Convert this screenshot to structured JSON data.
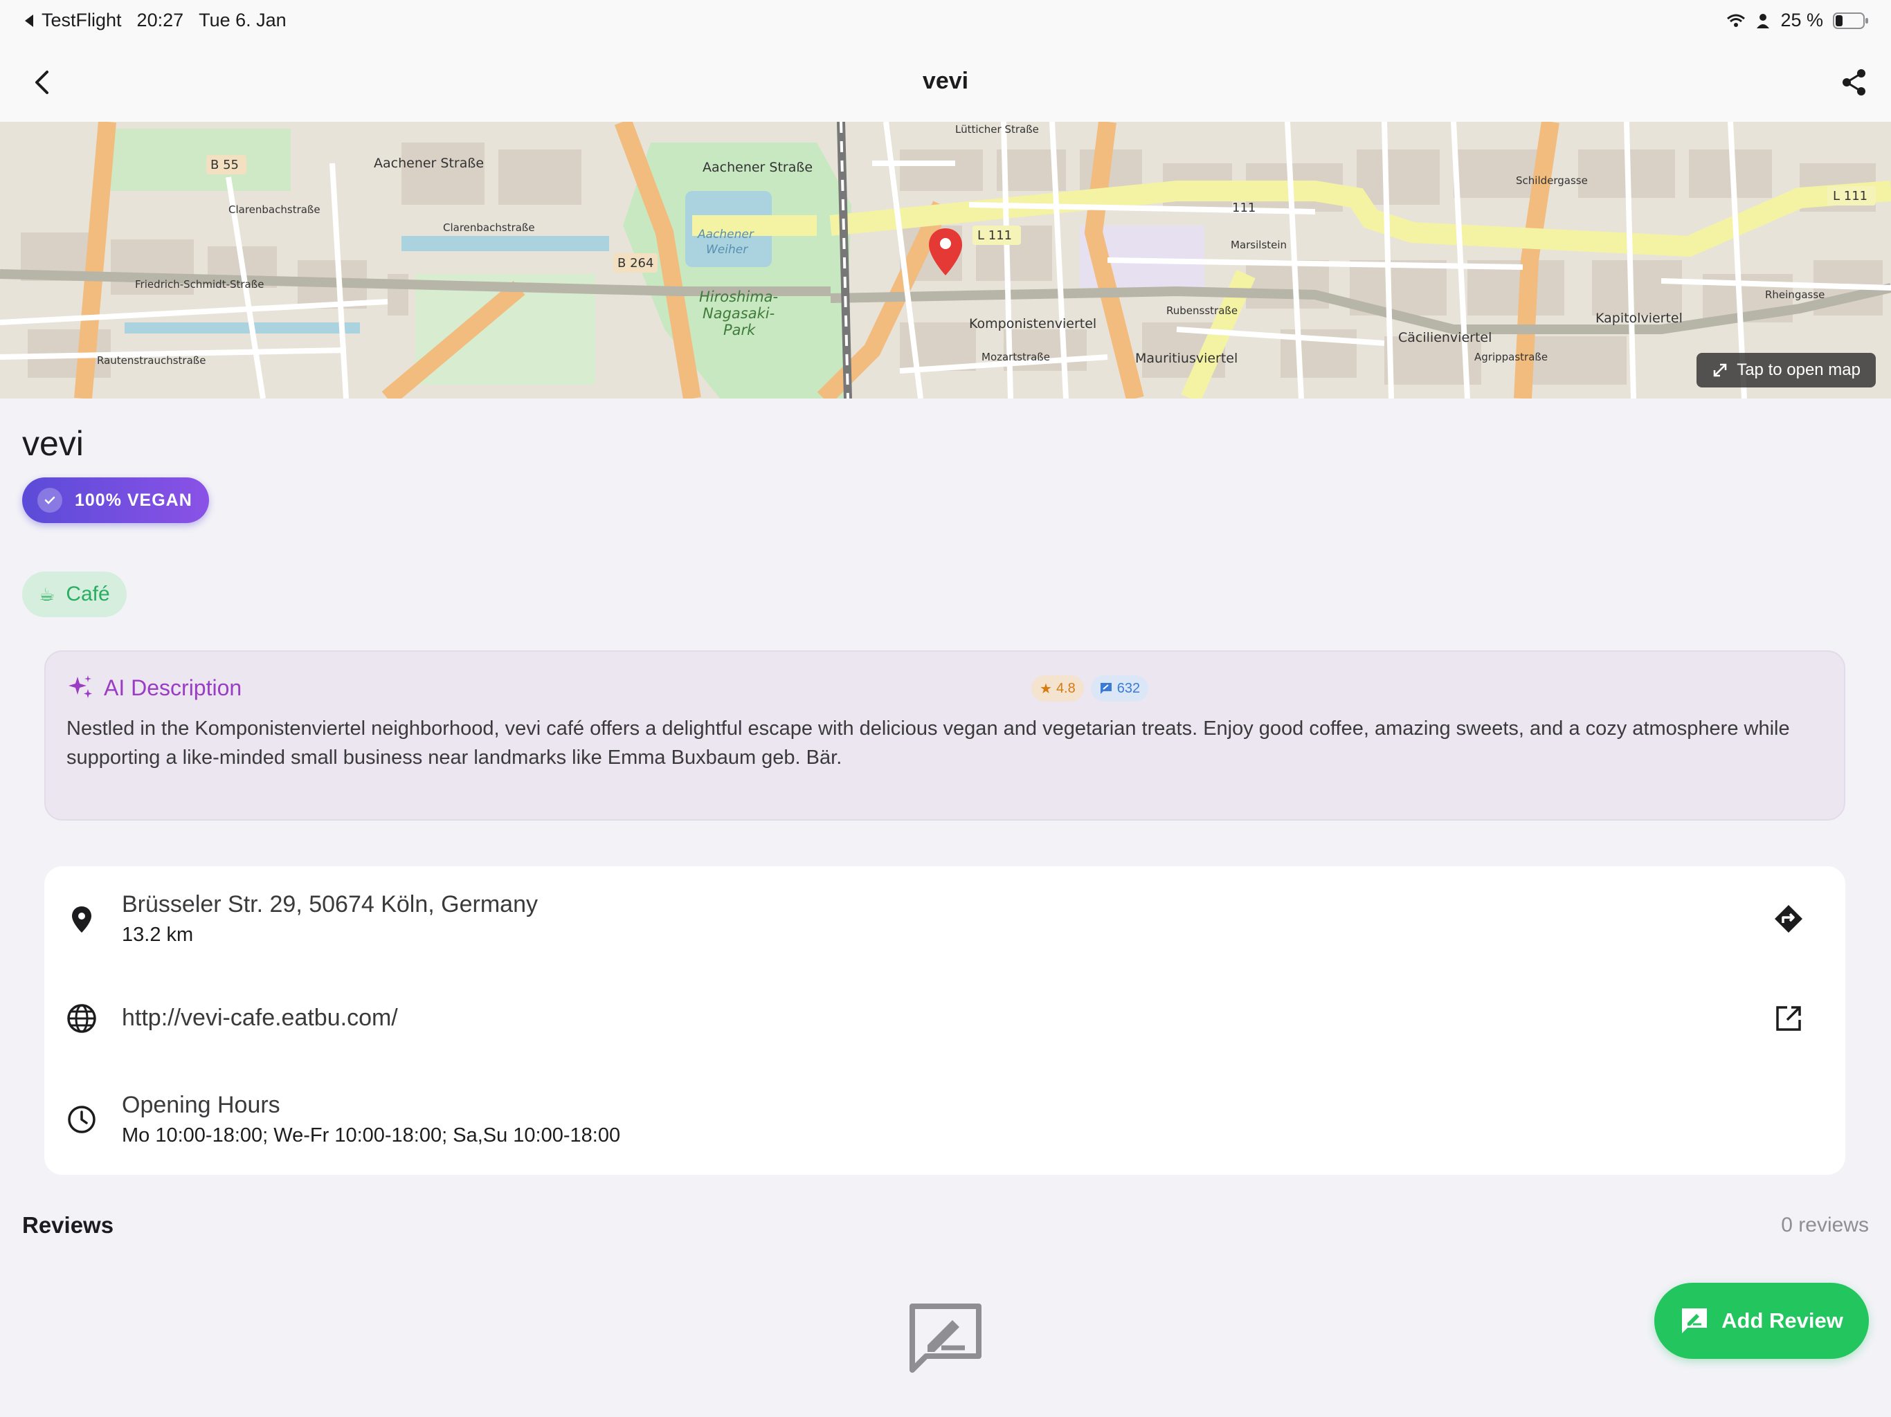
{
  "status_bar": {
    "back_app": "TestFlight",
    "time": "20:27",
    "date": "Tue 6. Jan",
    "battery": "25 %"
  },
  "nav": {
    "title": "vevi"
  },
  "map": {
    "open_label": "Tap to open map",
    "labels": {
      "b55": "B 55",
      "aachener1": "Aachener Straße",
      "aachener2": "Aachener Straße",
      "clarenbach1": "Clarenbachstraße",
      "clarenbach2": "Clarenbachstraße",
      "friedrich": "Friedrich-Schmidt-Straße",
      "rautenstrauch": "Rautenstrauchstraße",
      "b264": "B 264",
      "weiher1": "Aachener",
      "weiher2": "Weiher",
      "park1": "Hiroshima-",
      "park2": "Nagasaki-",
      "park3": "Park",
      "l111a": "L 111",
      "l111b": "111",
      "l111c": "L 111",
      "luetticher": "Lütticher Straße",
      "komponisten": "Komponistenviertel",
      "mozart": "Mozartstraße",
      "mauritius": "Mauritiusviertel",
      "rubens": "Rubensstraße",
      "marsilstein": "Marsilstein",
      "schilder": "Schildergasse",
      "caecilien": "Cäcilienviertel",
      "agrippa": "Agrippastraße",
      "kapitol": "Kapitolviertel",
      "rhein": "Rheingasse"
    }
  },
  "place": {
    "name": "vevi",
    "vegan_badge": "100% VEGAN",
    "category_emoji": "☕",
    "category": "Café"
  },
  "ai": {
    "heading": "AI Description",
    "rating": "4.8",
    "review_count": "632",
    "text": "Nestled in the Komponistenviertel neighborhood, vevi café offers a delightful escape with delicious vegan and vegetarian treats. Enjoy good coffee, amazing sweets, and a cozy atmosphere while supporting a like-minded small business near landmarks like Emma Buxbaum geb. Bär."
  },
  "info": {
    "address": "Brüsseler Str. 29, 50674 Köln, Germany",
    "distance": "13.2 km",
    "website": "http://vevi-cafe.eatbu.com/",
    "hours_label": "Opening Hours",
    "hours": "Mo 10:00-18:00; We-Fr 10:00-18:00; Sa,Su 10:00-18:00"
  },
  "reviews": {
    "title": "Reviews",
    "count": "0 reviews",
    "add_label": "Add Review"
  },
  "icons": {
    "back": "chevron-left-icon",
    "share": "share-icon",
    "location": "location-pin-icon",
    "directions": "directions-icon",
    "globe": "globe-icon",
    "open_external": "open-external-icon",
    "clock": "clock-icon",
    "sparkles": "sparkles-icon",
    "add_review": "rate-review-icon",
    "empty_reviews": "empty-review-icon"
  },
  "colors": {
    "accent_green": "#22c55e",
    "ai_purple": "#9b3dc4",
    "vegan_gradient_start": "#5b4bd8",
    "vegan_gradient_end": "#8a52e6",
    "map_pin": "#e53935"
  }
}
